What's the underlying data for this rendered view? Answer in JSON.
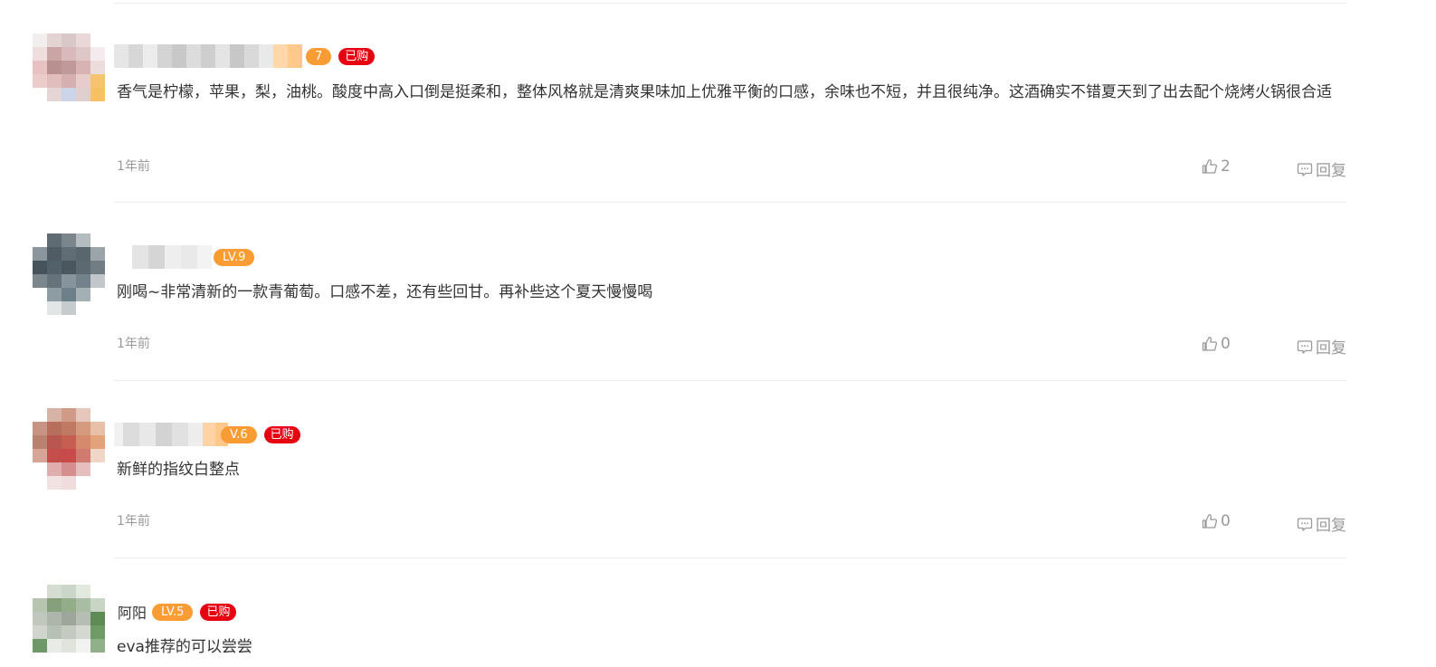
{
  "colors": {
    "level_badge": "#f99c33",
    "bought_badge": "#e60012",
    "meta_text": "#999999",
    "divider": "#ececec"
  },
  "comments": [
    {
      "nickname": "",
      "level": "7",
      "bought": "已购",
      "content": "香气是柠檬，苹果，梨，油桃。酸度中高入口倒是挺柔和，整体风格就是清爽果味加上优雅平衡的口感，余味也不短，并且很纯净。这酒确实不错夏天到了出去配个烧烤火锅很合适",
      "time": "1年前",
      "likes": "2",
      "reply": "回复"
    },
    {
      "nickname": "",
      "level": "LV.9",
      "bought": "",
      "content": "刚喝~非常清新的一款青葡萄。口感不差，还有些回甘。再补些这个夏天慢慢喝",
      "time": "1年前",
      "likes": "0",
      "reply": "回复"
    },
    {
      "nickname": "",
      "level": "V.6",
      "bought": "已购",
      "content": "新鲜的指纹白整点",
      "time": "1年前",
      "likes": "0",
      "reply": "回复"
    },
    {
      "nickname": "阿阳",
      "level": "LV.5",
      "bought": "已购",
      "content": "eva推荐的可以尝尝",
      "time": "",
      "likes": "",
      "reply": ""
    }
  ]
}
